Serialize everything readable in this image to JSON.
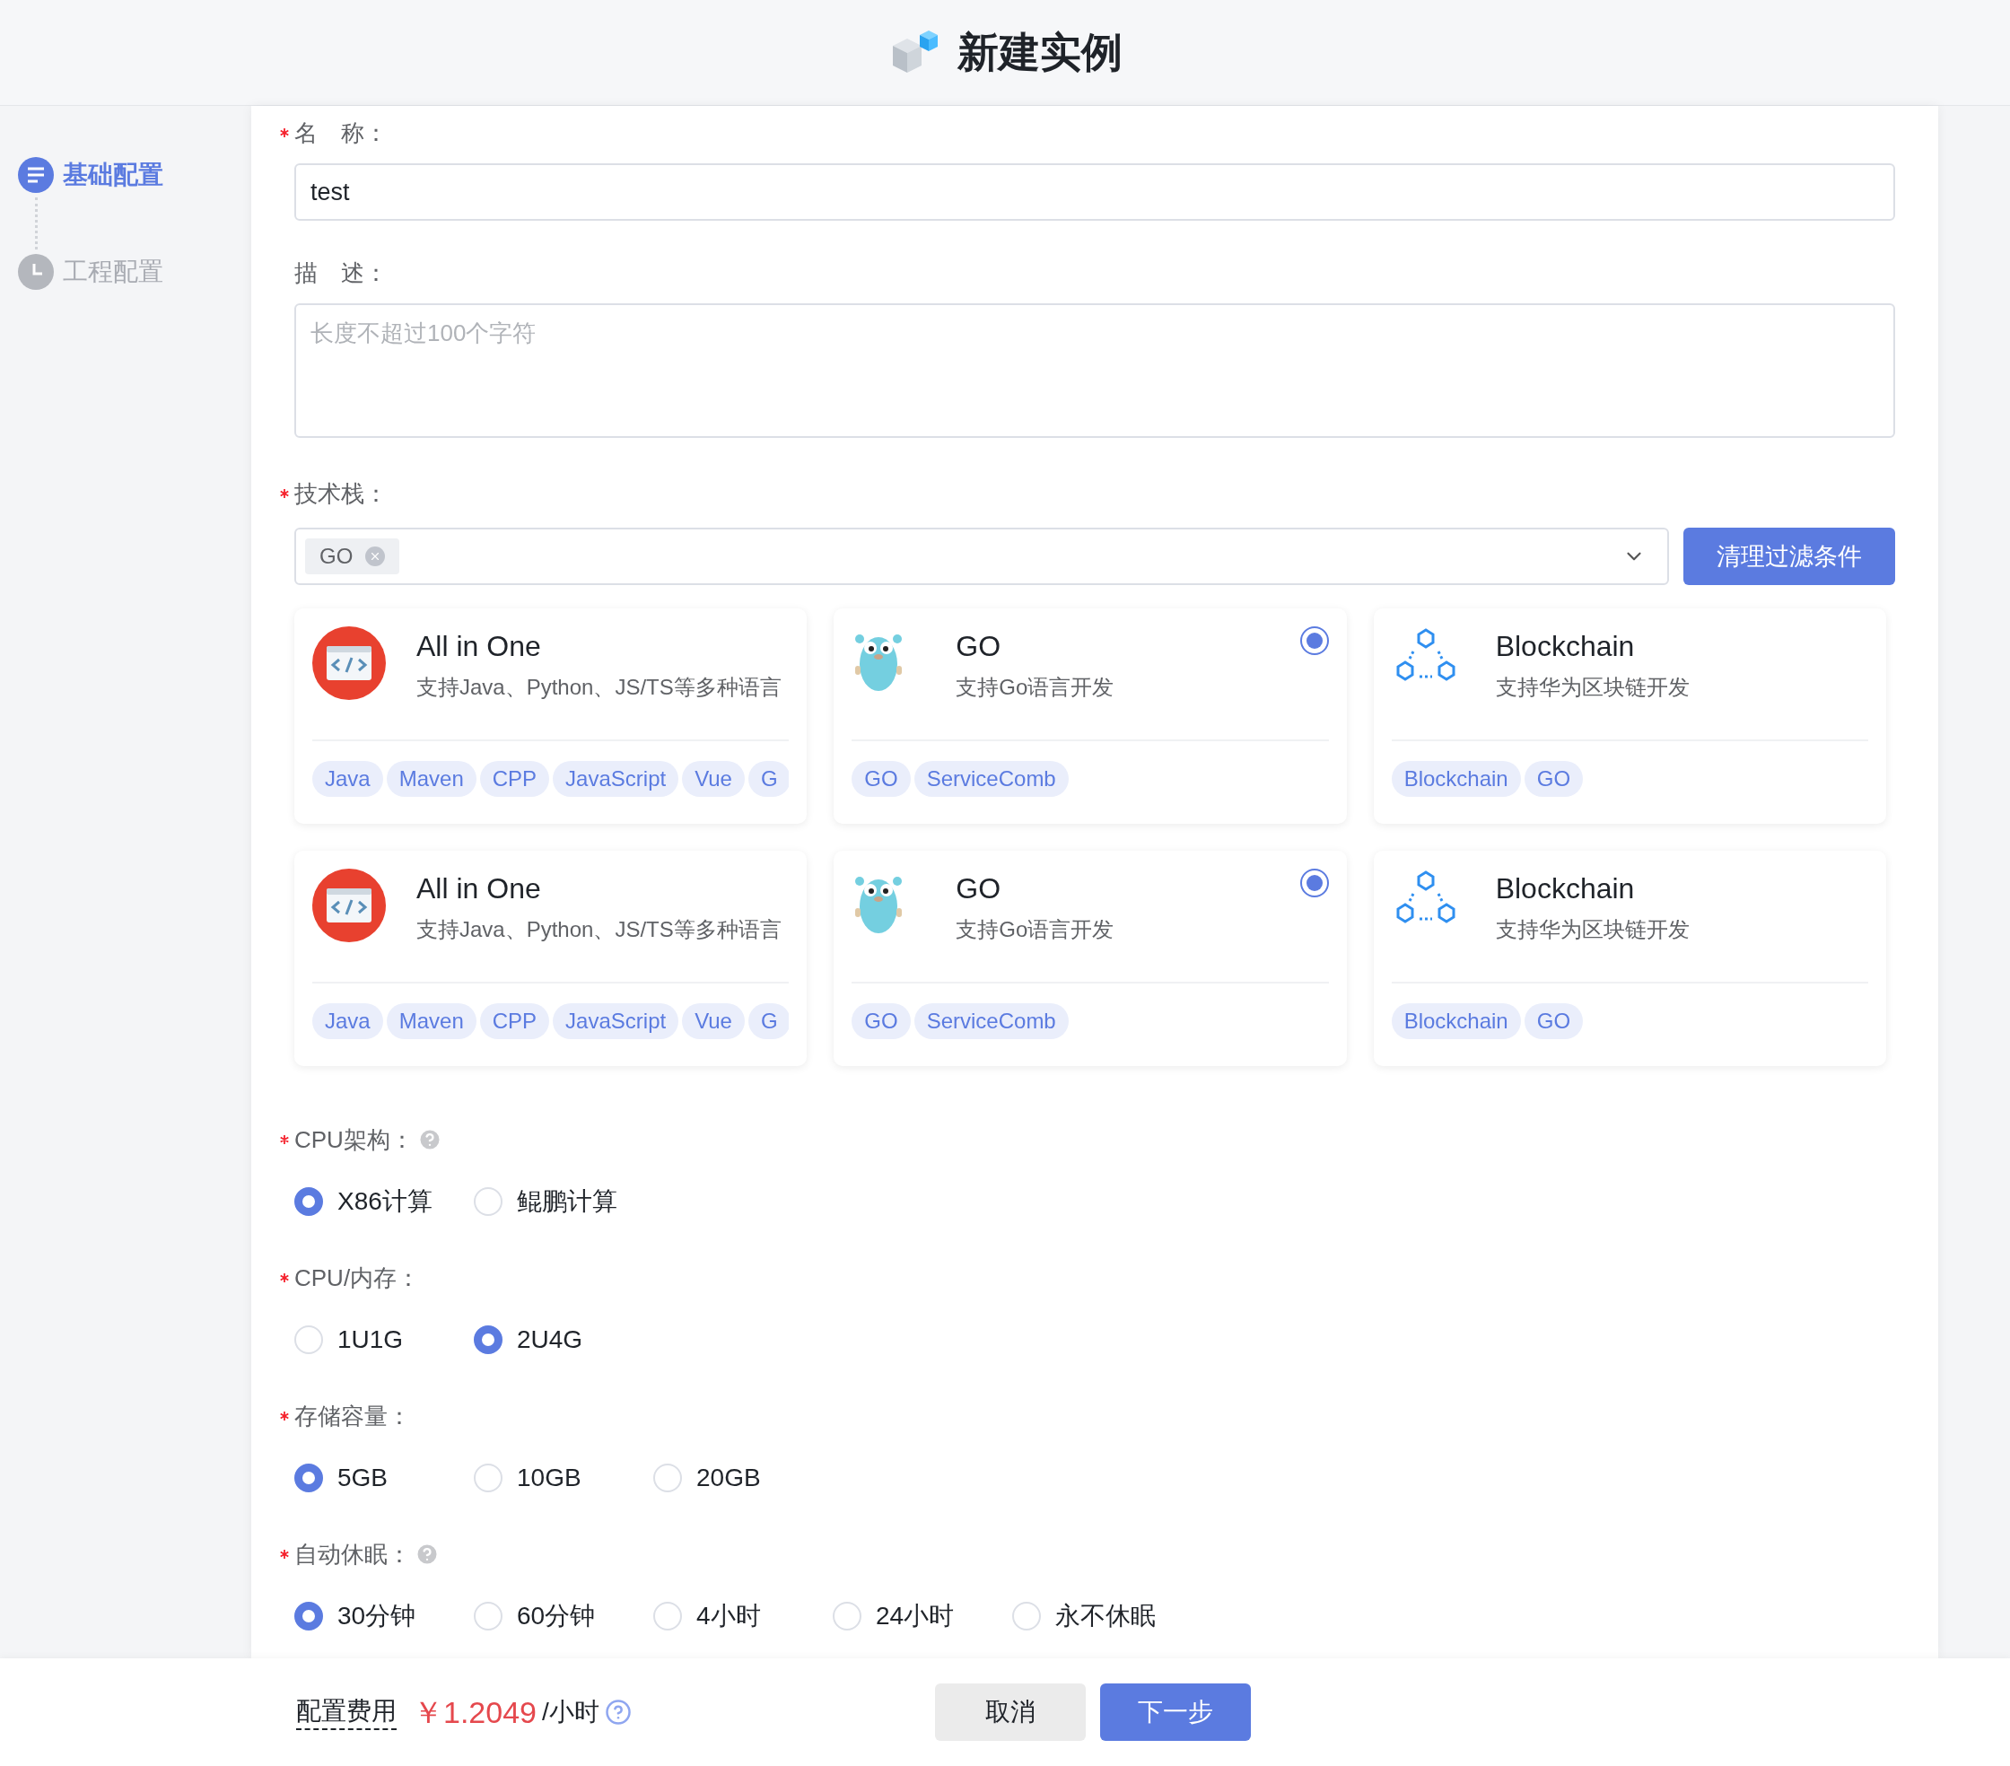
{
  "header": {
    "title": "新建实例"
  },
  "steps": [
    {
      "label": "基础配置",
      "selected": true,
      "kind": "list"
    },
    {
      "label": "工程配置",
      "selected": false,
      "kind": "clock"
    }
  ],
  "name": {
    "label": "名　称：",
    "required": true,
    "value": "test"
  },
  "description": {
    "label": "描　述：",
    "required": false,
    "placeholder": "长度不超过100个字符"
  },
  "tech_stack": {
    "label": "技术栈：",
    "required": true,
    "chips": [
      "GO"
    ],
    "clear_button": "清理过滤条件"
  },
  "templates": [
    {
      "kind": "allinone",
      "title": "All in One",
      "description": "支持Java、Python、JS/TS等多种语言",
      "tags": [
        "Java",
        "Maven",
        "CPP",
        "JavaScript",
        "Vue",
        "G"
      ],
      "selected": false
    },
    {
      "kind": "go",
      "title": "GO",
      "description": "支持Go语言开发",
      "tags": [
        "GO",
        "ServiceComb"
      ],
      "selected": true
    },
    {
      "kind": "blockchain",
      "title": "Blockchain",
      "description": "支持华为区块链开发",
      "tags": [
        "Blockchain",
        "GO"
      ],
      "selected": false
    },
    {
      "kind": "allinone",
      "title": "All in One",
      "description": "支持Java、Python、JS/TS等多种语言",
      "tags": [
        "Java",
        "Maven",
        "CPP",
        "JavaScript",
        "Vue",
        "G"
      ],
      "selected": false
    },
    {
      "kind": "go",
      "title": "GO",
      "description": "支持Go语言开发",
      "tags": [
        "GO",
        "ServiceComb"
      ],
      "selected": true
    },
    {
      "kind": "blockchain",
      "title": "Blockchain",
      "description": "支持华为区块链开发",
      "tags": [
        "Blockchain",
        "GO"
      ],
      "selected": false
    }
  ],
  "radio_groups": [
    {
      "label": "CPU架构：",
      "required": true,
      "help": true,
      "options": [
        {
          "label": "X86计算",
          "selected": true
        },
        {
          "label": "鲲鹏计算",
          "selected": false
        }
      ]
    },
    {
      "label": "CPU/内存：",
      "required": true,
      "help": false,
      "options": [
        {
          "label": "1U1G",
          "selected": false
        },
        {
          "label": "2U4G",
          "selected": true
        }
      ]
    },
    {
      "label": "存储容量：",
      "required": true,
      "help": false,
      "options": [
        {
          "label": "5GB",
          "selected": true
        },
        {
          "label": "10GB",
          "selected": false
        },
        {
          "label": "20GB",
          "selected": false
        }
      ]
    },
    {
      "label": "自动休眠：",
      "required": true,
      "help": true,
      "options": [
        {
          "label": "30分钟",
          "selected": true
        },
        {
          "label": "60分钟",
          "selected": false
        },
        {
          "label": "4小时",
          "selected": false
        },
        {
          "label": "24小时",
          "selected": false
        },
        {
          "label": "永不休眠",
          "selected": false
        }
      ]
    }
  ],
  "footer": {
    "cost_label": "配置费用",
    "price": "￥1.2049",
    "unit": "/小时",
    "buttons": [
      {
        "label": "取消",
        "kind": "secondary"
      },
      {
        "label": "下一步",
        "kind": "primary"
      }
    ]
  }
}
